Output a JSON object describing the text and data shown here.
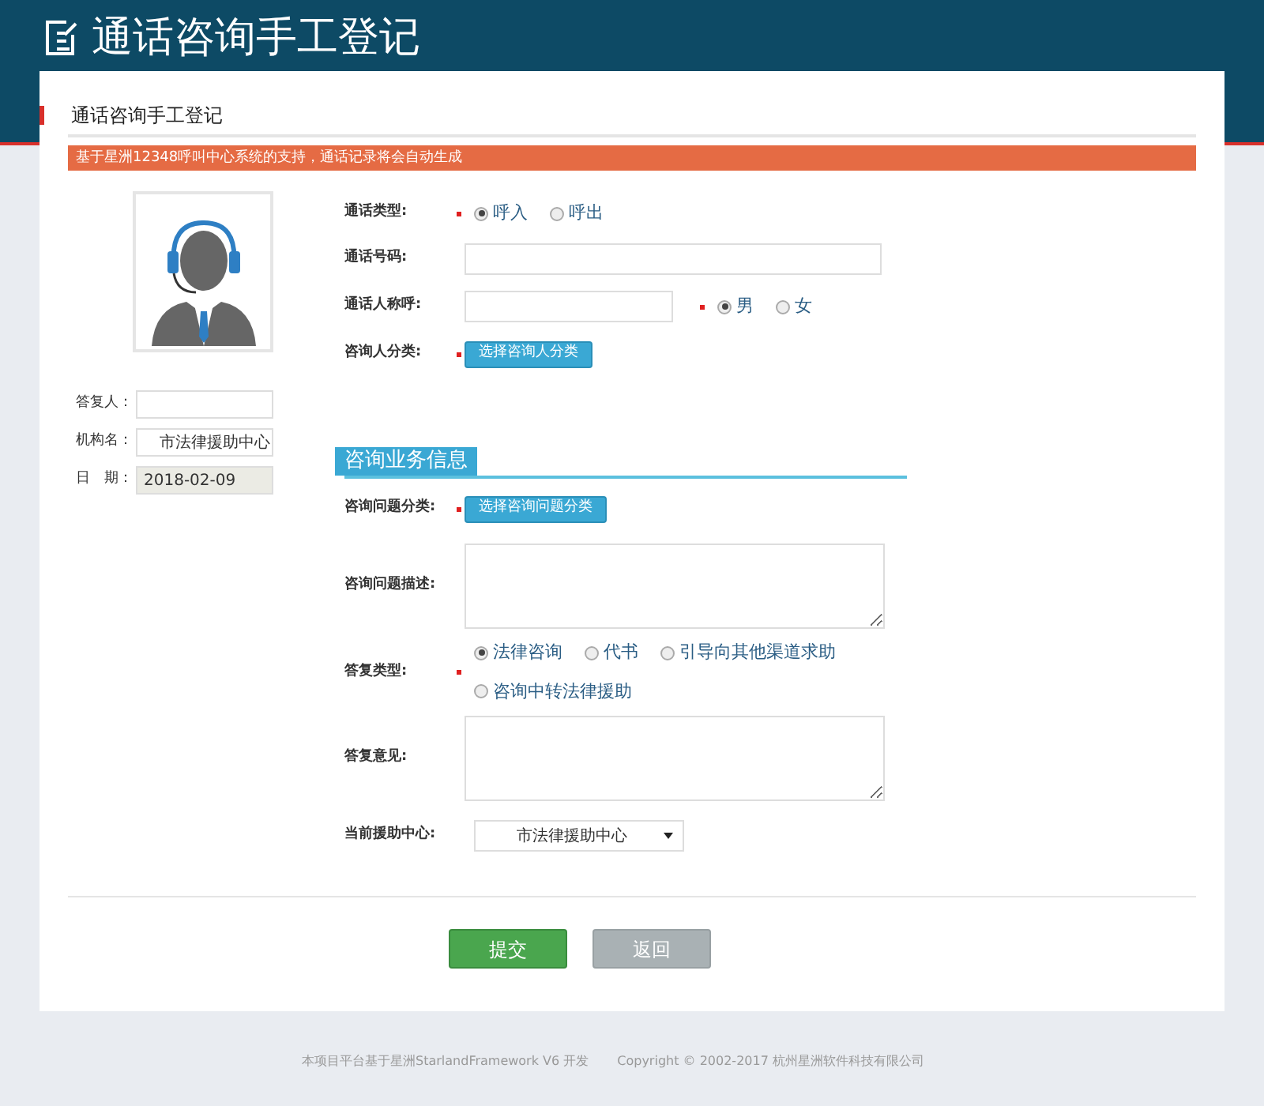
{
  "header": {
    "title": "通话咨询手工登记"
  },
  "panel": {
    "title": "通话咨询手工登记",
    "notice": "基于星洲12348呼叫中心系统的支持，通话记录将会自动生成"
  },
  "sidebar": {
    "fields": [
      {
        "label": "答复人：",
        "disabled": false
      },
      {
        "label": "机构名：",
        "value": "市法律援助中心",
        "disabled": false
      },
      {
        "label": "日　期：",
        "value": "2018-02-09",
        "disabled": true
      }
    ]
  },
  "call_rows": [
    {
      "kind": "radio",
      "label": "通话类型:",
      "required": true,
      "options": [
        {
          "label": "呼入",
          "selected": true
        },
        {
          "label": "呼出",
          "selected": false
        }
      ]
    },
    {
      "kind": "input",
      "label": "通话号码:",
      "required": false
    },
    {
      "kind": "input_radio",
      "label": "通话人称呼:",
      "required": true,
      "options": [
        {
          "label": "男",
          "selected": true
        },
        {
          "label": "女",
          "selected": false
        }
      ]
    },
    {
      "kind": "button",
      "label": "咨询人分类:",
      "required": true,
      "button": "选择咨询人分类"
    }
  ],
  "section": {
    "title": "咨询业务信息",
    "rows": [
      {
        "kind": "button",
        "label": "咨询问题分类:",
        "required": true,
        "button": "选择咨询问题分类"
      },
      {
        "kind": "textarea",
        "label": "咨询问题描述:",
        "required": false
      },
      {
        "kind": "radio",
        "label": "答复类型:",
        "required": true,
        "options": [
          {
            "label": "法律咨询",
            "selected": true
          },
          {
            "label": "代书",
            "selected": false
          },
          {
            "label": "引导向其他渠道求助",
            "selected": false
          },
          {
            "label": "咨询中转法律援助",
            "selected": false
          }
        ]
      },
      {
        "kind": "textarea",
        "label": "答复意见:",
        "required": false
      },
      {
        "kind": "select",
        "label": "当前援助中心:",
        "required": false,
        "value": "市法律援助中心"
      }
    ]
  },
  "actions": [
    {
      "label": "提交",
      "kind": "primary"
    },
    {
      "label": "返回",
      "kind": "secondary"
    }
  ],
  "footer": [
    "本项目平台基于星洲StarlandFramework V6 开发",
    "Copyright © 2002-2017 杭州星洲软件科技有限公司"
  ]
}
